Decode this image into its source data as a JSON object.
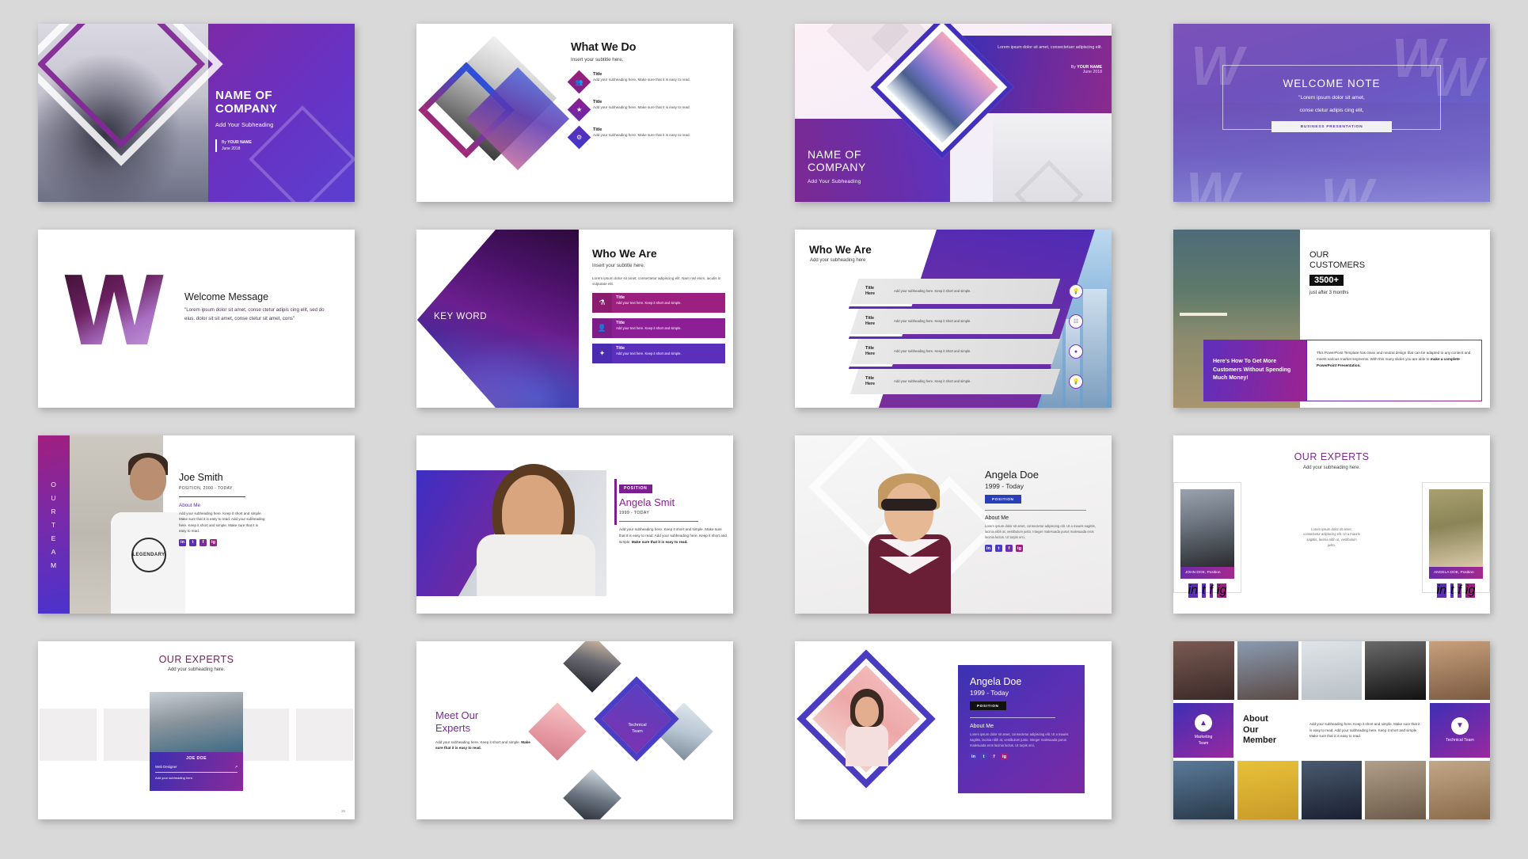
{
  "deck": {
    "slides": [
      {
        "id": "title-company",
        "title": "NAME OF\nCOMPANY",
        "title_line1": "NAME OF",
        "title_line2": "COMPANY",
        "subheading": "Add Your Subheading",
        "by_prefix": "By ",
        "by_name": "YOUR NAME",
        "date": "June 2018"
      },
      {
        "id": "what-we-do",
        "title": "What We Do",
        "subtitle": "Insert your subtitle here.",
        "items": [
          {
            "title": "Title",
            "text": "Add your subheading here. Make sure that it is easy to read.",
            "icon": "people-icon"
          },
          {
            "title": "Title",
            "text": "Add your subheading here. Make sure that it is easy to read.",
            "icon": "badge-icon"
          },
          {
            "title": "Title",
            "text": "Add your subheading here. Make sure that it is easy to read.",
            "icon": "network-icon"
          }
        ]
      },
      {
        "id": "title-company-diamond",
        "title_line1": "NAME OF",
        "title_line2": "COMPANY",
        "subheading": "Add Your Subheading",
        "lorem": "Lorem ipsum dolor sit amet, consectetuer adipiscing elit.",
        "by_prefix": "By ",
        "by_name": "YOUR NAME",
        "date": "June 2018"
      },
      {
        "id": "welcome-note",
        "title": "WELCOME NOTE",
        "quote_line1": "\"Lorem ipsum dolor sit amet,",
        "quote_line2": "conse ctetur adipis cing elit,",
        "button": "BUSINESS PRESENTATION",
        "watermark": "W"
      },
      {
        "id": "welcome-message",
        "logo_letter": "W",
        "title": "Welcome Message",
        "body": "\"Lorem ipsum dolor sit amet, conse ctetur adipis cing elit, sed do eius. dolor sit sit amet, conse ctetur sit amet, cons\""
      },
      {
        "id": "who-we-are-keyword",
        "keyword": "KEY WORD",
        "title": "Who We Are",
        "subtitle": "Insert your subtitle here.",
        "lead": "Lorem ipsum dolor sit amet, consectetur adipiscing elit. Nam nisl enim, iaculis in vulputate elit.",
        "bars": [
          {
            "title": "Title",
            "text": "Add your text here. Keep it short and simple.",
            "icon": "lab-icon"
          },
          {
            "title": "Title",
            "text": "Add your text here. Keep it short and simple.",
            "icon": "person-icon"
          },
          {
            "title": "Title",
            "text": "Add your text here. Keep it short and simple.",
            "icon": "network-icon"
          }
        ]
      },
      {
        "id": "who-we-are-chevrons",
        "title": "Who We Are",
        "subtitle": "Add your subheading here",
        "rows": [
          {
            "title_l1": "Title",
            "title_l2": "Here",
            "text": "Add your subheading here. Keep it short and simple.",
            "icon": "lightbulb-icon"
          },
          {
            "title_l1": "Title",
            "title_l2": "Here",
            "text": "Add your subheading here. Keep it short and simple.",
            "icon": "org-chart-icon"
          },
          {
            "title_l1": "Title",
            "title_l2": "Here",
            "text": "Add your subheading here. Keep it short and simple.",
            "icon": "location-icon"
          },
          {
            "title_l1": "Title",
            "title_l2": "Here",
            "text": "Add your subheading here. Keep it short and simple.",
            "icon": "lightbulb-icon"
          }
        ]
      },
      {
        "id": "our-customers",
        "title_l1": "OUR",
        "title_l2": "CUSTOMERS",
        "count": "3500+",
        "caption": "just after 3 months",
        "promo": "Here's How To Get More Customers Without Spending Much Money!",
        "description_plain": "This PowerPoint Template has clean and neutral design that can be adapted to any content and meets various market segments. With this many slides you are able to ",
        "description_bold": "make a complete PowerPoint Presentation."
      },
      {
        "id": "team-joe-smith",
        "side_label": "OUR TEAM",
        "side_chars": [
          "O",
          "U",
          "R",
          "T",
          "E",
          "A",
          "M"
        ],
        "name": "Joe Smith",
        "position": "POSITION, 2000 - TODAY",
        "about_label": "About Me",
        "about_text": "Add your subheading here. Keep it short and simple. Make sure that it is easy to read. Add your subheading here. Keep it short and simple. Make sure that it is easy to read.",
        "shirt_text": "LEGENDARY",
        "social": [
          "in",
          "t",
          "f",
          "ig"
        ]
      },
      {
        "id": "team-angela-smit",
        "tag": "POSITION",
        "name": "Angela Smit",
        "years": "1999 - TODAY",
        "body_plain": "Add your subheading here. Keep it short and simple. Make sure that it is easy to read. Add your subheading here. Keep it short and simple. ",
        "body_bold": "Make sure that it is easy to read."
      },
      {
        "id": "team-angela-doe",
        "name": "Angela Doe",
        "years": "1999 - Today",
        "tag": "POSITION",
        "about_label": "About Me",
        "about_text": "Lorem ipsum dolor sit amet, consectetur adipiscing elit. Ut a mauris sagittis, lacinia nibh at, vestibulum justo. Integer malesuada purus malesuada eros lacinia luctus. Ut turpis orci,",
        "social": [
          "in",
          "t",
          "f",
          "ig"
        ]
      },
      {
        "id": "our-experts-two",
        "title": "OUR EXPERTS",
        "subtitle": "Add your subheading here.",
        "middle_text": "Lorem ipsum dolor sit amet, consectetur adipiscing elit. Ut a mauris sagittis, lacinia nibh ut, vestibulum justo.",
        "cards": [
          {
            "name": "JOHN DOE, Position",
            "social": [
              "in",
              "t",
              "f",
              "ig"
            ]
          },
          {
            "name": "ANGELA DOE, Position",
            "social": [
              "in",
              "t",
              "f",
              "ig"
            ]
          }
        ]
      },
      {
        "id": "our-experts-carousel",
        "title": "OUR EXPERTS",
        "subtitle": "Add your subheading here.",
        "card_name": "JOE DOE",
        "card_role": "Web Designer",
        "card_sub": "Add your subheading here.",
        "page_number": "25"
      },
      {
        "id": "meet-our-experts",
        "title_l1": "Meet Our",
        "title_l2": "Experts",
        "body_plain": "Add your subheading here. Keep it short and simple. ",
        "body_bold": "Make sure that it is easy to read.",
        "center_l1": "Technical",
        "center_l2": "Team"
      },
      {
        "id": "angela-doe-diamond",
        "name": "Angela Doe",
        "years": "1999 - Today",
        "tag": "POSITION",
        "about_label": "About Me",
        "about_text": "Lorem ipsum dolor sit amet, consectetur adipiscing elit. Ut a mauris sagittis, lacinia nibh at, vestibulum justo. Integer malesuada purus malesuada eros lacinia luctus. Ut turpis orci,",
        "social": [
          "in",
          "t",
          "f",
          "ig"
        ]
      },
      {
        "id": "about-our-member",
        "left_team_l1": "Marketing",
        "left_team_l2": "Team",
        "right_team": "Technical Team",
        "title_l1": "About",
        "title_l2": "Our",
        "title_l3": "Member",
        "text": "Add your subheading here. Keep it short and simple. Make sure that it is easy to read. Add your subheading here. Keep it short and simple. Make sure that it is easy to read."
      }
    ]
  },
  "colors": {
    "purple_dark": "#4a2d8f",
    "purple": "#7a2a9c",
    "magenta": "#9c2080",
    "blue_violet": "#4230bd",
    "accent_pink": "#e79aa4",
    "background": "#d9d9d9"
  }
}
